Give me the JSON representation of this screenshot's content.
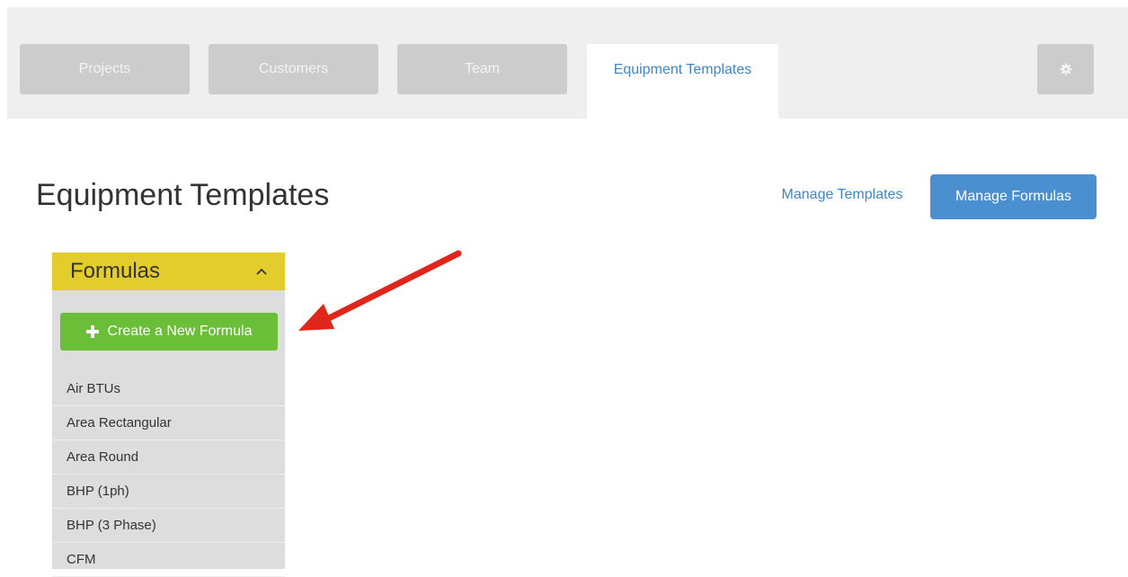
{
  "nav": {
    "tabs": [
      {
        "label": "Projects"
      },
      {
        "label": "Customers"
      },
      {
        "label": "Team"
      },
      {
        "label": "Equipment Templates"
      }
    ],
    "settings_icon": "gear-icon"
  },
  "page": {
    "title": "Equipment Templates",
    "manage_templates_label": "Manage Templates",
    "manage_formulas_label": "Manage Formulas"
  },
  "formulas_panel": {
    "title": "Formulas",
    "collapse_icon": "chevron-up-icon",
    "create_label": "Create a New Formula",
    "create_icon": "plus-icon",
    "items": [
      "Air BTUs",
      "Area Rectangular",
      "Area Round",
      "BHP (1ph)",
      "BHP (3 Phase)",
      "CFM"
    ]
  },
  "colors": {
    "accent": "#3f87c7",
    "primary_button": "#4a8fd0",
    "panel_header": "#e3cd2c",
    "create_button": "#6bbe38",
    "annotation_arrow": "#e0261b"
  }
}
